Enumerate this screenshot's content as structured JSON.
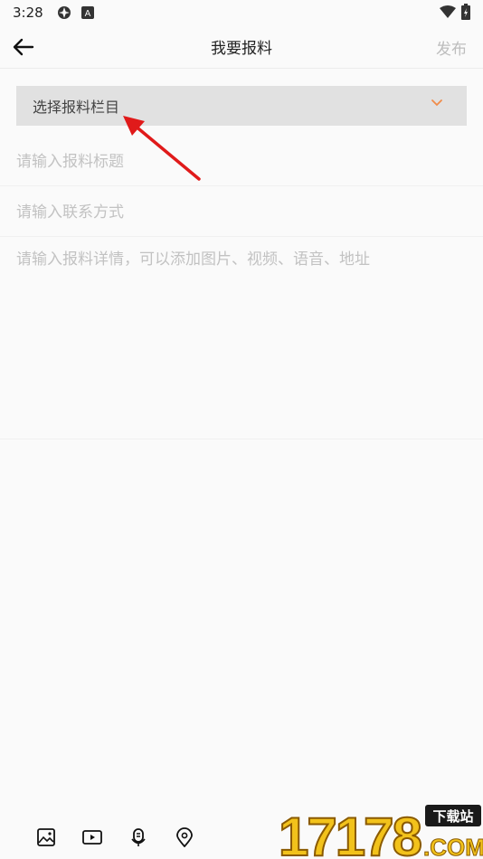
{
  "status_bar": {
    "time": "3:28",
    "notification_letter": "A"
  },
  "app_bar": {
    "title": "我要报料",
    "publish_label": "发布"
  },
  "form": {
    "column_select_placeholder": "选择报料栏目",
    "title_placeholder": "请输入报料标题",
    "contact_placeholder": "请输入联系方式",
    "detail_placeholder": "请输入报料详情，可以添加图片、视频、语音、地址"
  },
  "toolbar": {
    "icons": [
      "image-icon",
      "video-icon",
      "microphone-icon",
      "location-pin-icon"
    ]
  },
  "watermark": {
    "brand_number": "17178",
    "badge": "下载站",
    "domain": ".COM"
  },
  "colors": {
    "accent_orange": "#f08c4a",
    "annotation_red": "#e01a1a",
    "placeholder_gray": "#c2c2c2",
    "select_bg": "#e1e1e1"
  }
}
